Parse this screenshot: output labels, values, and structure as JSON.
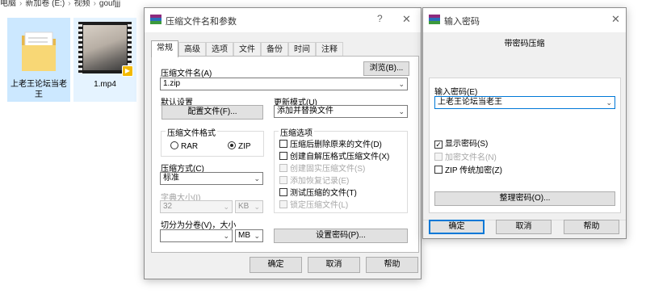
{
  "explorer": {
    "breadcrumb": [
      "电脑",
      "›",
      "新加卷 (E:)",
      "›",
      "视频",
      "›",
      "goufjjj"
    ],
    "files": [
      {
        "name": "上老王论坛当老王",
        "icon": "folder-icon"
      },
      {
        "name": "1.mp4",
        "icon": "video-thumbnail-icon"
      }
    ]
  },
  "archive_dialog": {
    "title": "压缩文件名和参数",
    "help_btn": "?",
    "close_btn": "✕",
    "tabs": [
      "常规",
      "高级",
      "选项",
      "文件",
      "备份",
      "时间",
      "注释"
    ],
    "archive_name_label": "压缩文件名(A)",
    "browse_button": "浏览(B)...",
    "archive_name_value": "1.zip",
    "default_settings_label": "默认设置",
    "profiles_button": "配置文件(F)...",
    "update_mode_label": "更新模式(U)",
    "update_mode_value": "添加并替换文件",
    "format_group_title": "压缩文件格式",
    "format_rar": "RAR",
    "format_zip": "ZIP",
    "selected_format": "ZIP",
    "method_label": "压缩方式(C)",
    "method_value": "标准",
    "dict_label": "字典大小(I)",
    "dict_value": "32",
    "dict_unit": "KB",
    "split_label": "切分为分卷(V)，大小",
    "split_value": "",
    "split_unit": "MB",
    "options_group_title": "压缩选项",
    "options": [
      {
        "label": "压缩后删除原来的文件(D)",
        "checked": false,
        "enabled": true
      },
      {
        "label": "创建自解压格式压缩文件(X)",
        "checked": false,
        "enabled": true
      },
      {
        "label": "创建固实压缩文件(S)",
        "checked": false,
        "enabled": false
      },
      {
        "label": "添加恢复记录(E)",
        "checked": false,
        "enabled": false
      },
      {
        "label": "测试压缩的文件(T)",
        "checked": false,
        "enabled": true
      },
      {
        "label": "锁定压缩文件(L)",
        "checked": false,
        "enabled": false
      }
    ],
    "set_password_button": "设置密码(P)...",
    "ok_button": "确定",
    "cancel_button": "取消",
    "help_button": "帮助"
  },
  "password_dialog": {
    "title": "输入密码",
    "close_btn": "✕",
    "subtitle": "带密码压缩",
    "password_label": "输入密码(E)",
    "password_value": "上老王论坛当老王",
    "show_password": {
      "label": "显示密码(S)",
      "checked": true,
      "enabled": true
    },
    "encrypt_names": {
      "label": "加密文件名(N)",
      "checked": false,
      "enabled": false
    },
    "zip_legacy": {
      "label": "ZIP 传统加密(Z)",
      "checked": false,
      "enabled": true
    },
    "organize_button": "整理密码(O)...",
    "ok_button": "确定",
    "cancel_button": "取消",
    "help_button": "帮助"
  },
  "colors": {
    "accent": "#0078d7",
    "folder": "#f8d775",
    "selection": "#cce8ff"
  }
}
